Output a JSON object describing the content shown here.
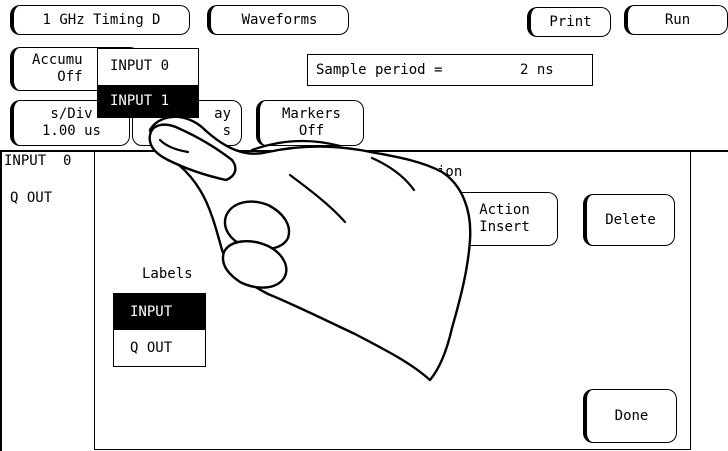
{
  "top_bar": {
    "mode_button": "1 GHz Timing D",
    "waveforms_button": "Waveforms",
    "print_button": "Print",
    "run_button": "Run"
  },
  "controls": {
    "accumulate_label": "Accumu\n   Off",
    "sample_period_label": "Sample period =",
    "sample_period_value": "2 ns",
    "sdiv_button": "s/Div\n1.00 us",
    "delay_button": "ay\n s",
    "markers_button": "Markers\nOff"
  },
  "dropdown": {
    "items": [
      "INPUT  0",
      "INPUT  1"
    ],
    "selected_index": 1
  },
  "waveform_list": {
    "labels": [
      "INPUT  0",
      "Q OUT"
    ]
  },
  "dialog": {
    "title_fragment": "ion",
    "action_button": "Action\nInsert",
    "delete_button": "Delete",
    "labels_heading": "Labels",
    "label_items": [
      "INPUT",
      "Q OUT"
    ],
    "selected_label_index": 0,
    "done_button": "Done"
  }
}
